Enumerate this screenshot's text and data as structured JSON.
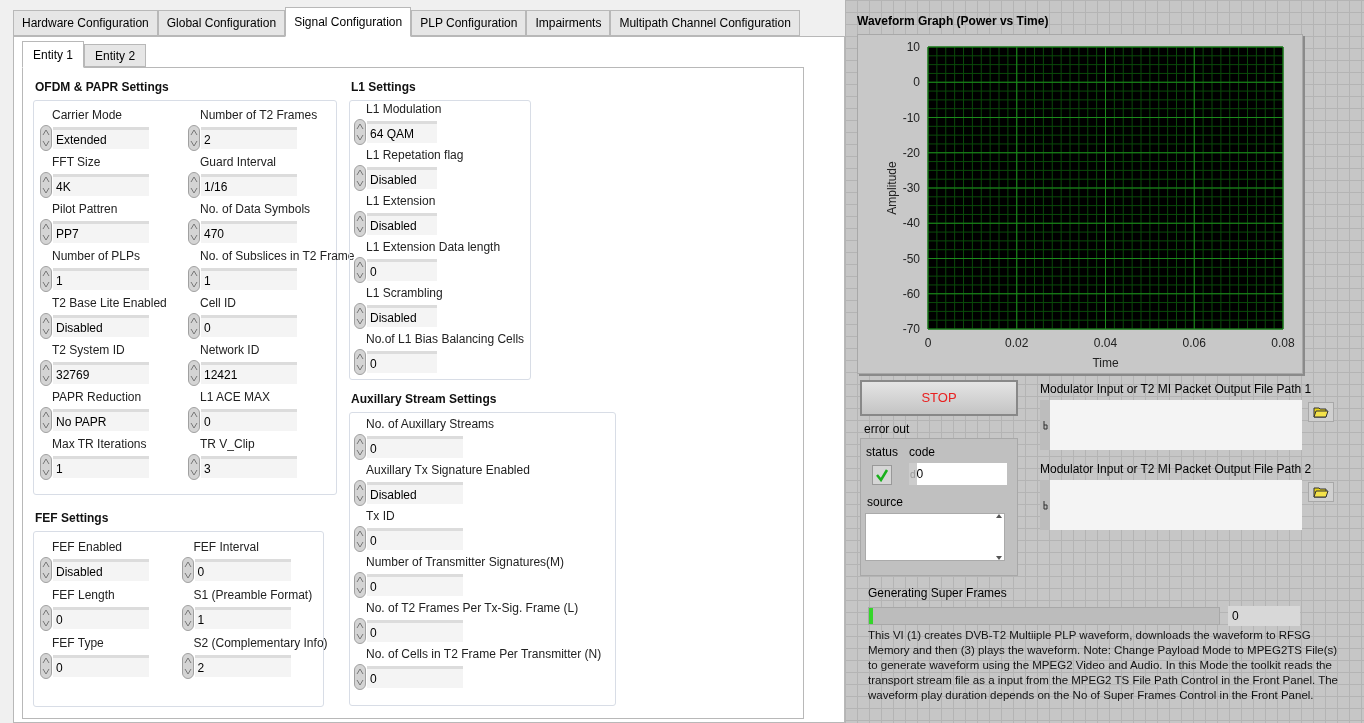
{
  "tabs": [
    {
      "label": "Hardware Configuration",
      "selected": false
    },
    {
      "label": "Global Configuration",
      "selected": false
    },
    {
      "label": "Signal Configuration",
      "selected": true
    },
    {
      "label": "PLP Configuration",
      "selected": false
    },
    {
      "label": "Impairments",
      "selected": false
    },
    {
      "label": "Multipath Channel Configuration",
      "selected": false
    }
  ],
  "entity_tabs": [
    {
      "label": "Entity 1",
      "selected": true
    },
    {
      "label": "Entity 2",
      "selected": false
    }
  ],
  "ofdm_papr_settings": {
    "title": "OFDM & PAPR Settings",
    "fields": [
      {
        "label": "Carrier Mode",
        "value": "Extended"
      },
      {
        "label": "Number of T2 Frames",
        "value": "2"
      },
      {
        "label": "FFT Size",
        "value": "4K"
      },
      {
        "label": "Guard Interval",
        "value": "1/16"
      },
      {
        "label": "Pilot Pattren",
        "value": "PP7"
      },
      {
        "label": "No. of Data Symbols",
        "value": "470"
      },
      {
        "label": "Number of PLPs",
        "value": "1"
      },
      {
        "label": "No. of Subslices in T2 Frame",
        "value": "1"
      },
      {
        "label": "T2 Base Lite Enabled",
        "value": "Disabled"
      },
      {
        "label": "Cell ID",
        "value": "0"
      },
      {
        "label": "T2 System ID",
        "value": "32769"
      },
      {
        "label": "Network ID",
        "value": "12421"
      },
      {
        "label": "PAPR Reduction",
        "value": "No PAPR"
      },
      {
        "label": "L1 ACE MAX",
        "value": "0"
      },
      {
        "label": "Max TR Iterations",
        "value": "1"
      },
      {
        "label": "TR V_Clip",
        "value": "3"
      }
    ]
  },
  "fef_settings": {
    "title": "FEF Settings",
    "fields": [
      {
        "label": "FEF Enabled",
        "value": "Disabled"
      },
      {
        "label": "FEF Interval",
        "value": "0"
      },
      {
        "label": "FEF Length",
        "value": "0"
      },
      {
        "label": "S1 (Preamble Format)",
        "value": "1"
      },
      {
        "label": "FEF Type",
        "value": "0"
      },
      {
        "label": "S2 (Complementary Info)",
        "value": "2"
      }
    ]
  },
  "l1_settings": {
    "title": "L1 Settings",
    "fields": [
      {
        "label": "L1 Modulation",
        "value": "64 QAM"
      },
      {
        "label": "L1 Repetation flag",
        "value": "Disabled"
      },
      {
        "label": "L1 Extension",
        "value": "Disabled"
      },
      {
        "label": "L1 Extension Data length",
        "value": "0"
      },
      {
        "label": "L1 Scrambling",
        "value": "Disabled"
      },
      {
        "label": "No.of L1 Bias Balancing Cells",
        "value": "0"
      }
    ]
  },
  "auxillary_stream_settings": {
    "title": "Auxillary Stream Settings",
    "fields": [
      {
        "label": "No. of Auxillary Streams",
        "value": "0"
      },
      {
        "label": "Auxillary Tx Signature Enabled",
        "value": "Disabled"
      },
      {
        "label": "Tx ID",
        "value": "0"
      },
      {
        "label": "Number of Transmitter Signatures(M)",
        "value": "0"
      },
      {
        "label": "No. of T2 Frames Per Tx-Sig. Frame (L)",
        "value": "0"
      },
      {
        "label": "No. of Cells in T2 Frame Per Transmitter (N)",
        "value": "0"
      }
    ]
  },
  "waveform_graph": {
    "title": "Waveform Graph (Power vs Time)",
    "chart_data": {
      "type": "line",
      "xlabel": "Time",
      "ylabel": "Amplitude",
      "xlim": [
        0,
        0.08
      ],
      "ylim": [
        -70,
        10
      ],
      "xticks": [
        0,
        0.02,
        0.04,
        0.06,
        0.08
      ],
      "yticks": [
        10,
        0,
        -10,
        -20,
        -30,
        -40,
        -50,
        -60,
        -70
      ],
      "grid": true
    }
  },
  "stop_button": "STOP",
  "error_out": {
    "label": "error out",
    "status_label": "status",
    "status_ok": true,
    "code_label": "code",
    "code_radix": "d",
    "code": "0",
    "source_label": "source"
  },
  "file_paths": [
    {
      "label": "Modulator Input or T2 MI Packet Output File Path 1"
    },
    {
      "label": "Modulator Input or T2 MI Packet Output File Path 2"
    }
  ],
  "progress": {
    "label": "Generating Super Frames",
    "level": 0.01,
    "value": "0"
  },
  "description": "This VI (1) creates DVB-T2 Multiiple PLP waveform, downloads the waveform to RFSG Memory and then (3) plays the waveform. Note: Change Payload Mode to MPEG2TS File(s) to generate waveform using the MPEG2 Video and Audio. In this Mode the toolkit reads the transport stream file as a input from the MPEG2 TS File Path Control in the Front Panel. The waveform play duration depends on the No of Super Frames Control in the Front Panel."
}
